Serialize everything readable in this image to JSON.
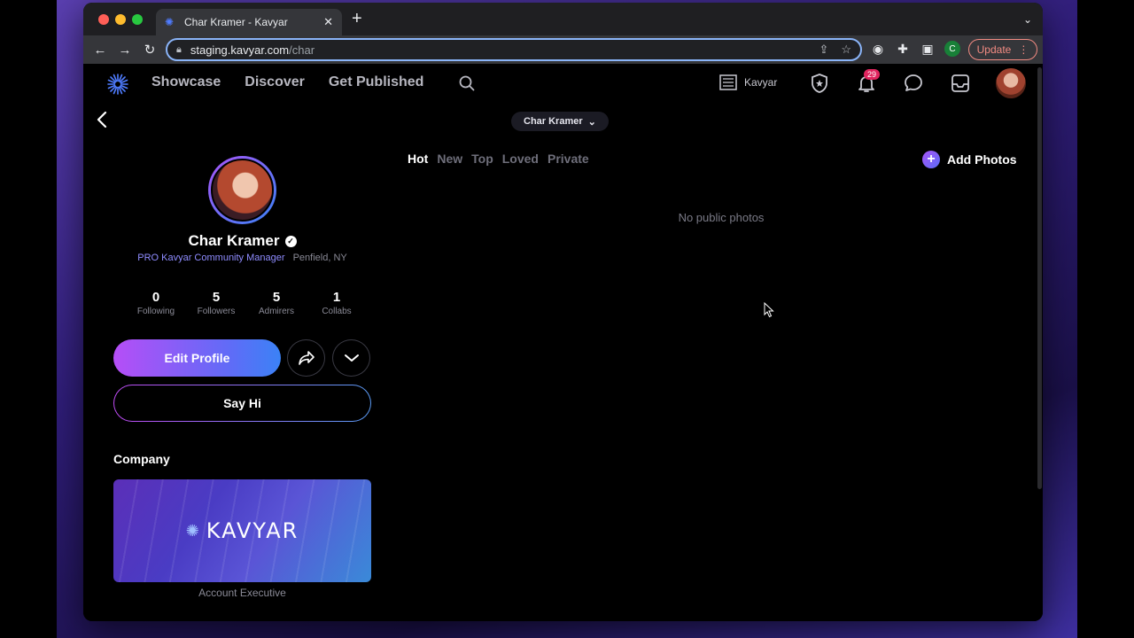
{
  "browser": {
    "tab_title": "Char Kramer - Kavyar",
    "url_host": "staging.kavyar.com",
    "url_path": "/char",
    "update_label": "Update",
    "profile_initial": "C"
  },
  "nav": {
    "links": [
      "Showcase",
      "Discover",
      "Get Published"
    ],
    "studio_label": "Kavyar",
    "notification_count": "29"
  },
  "switcher": {
    "label": "Char Kramer"
  },
  "profile": {
    "name": "Char Kramer",
    "role": "PRO Kavyar Community Manager",
    "location": "Penfield, NY",
    "stats": [
      {
        "num": "0",
        "label": "Following"
      },
      {
        "num": "5",
        "label": "Followers"
      },
      {
        "num": "5",
        "label": "Admirers"
      },
      {
        "num": "1",
        "label": "Collabs"
      }
    ],
    "edit_label": "Edit Profile",
    "sayhi_label": "Say Hi"
  },
  "company": {
    "heading": "Company",
    "name": "KAVYAR",
    "role": "Account Executive"
  },
  "photos": {
    "tabs": [
      "Hot",
      "New",
      "Top",
      "Loved",
      "Private"
    ],
    "active_tab": "Hot",
    "add_label": "Add Photos",
    "empty_text": "No public photos"
  },
  "colors": {
    "accent": "#a855f7",
    "accent2": "#3b82f6",
    "badge": "#e0245e"
  }
}
